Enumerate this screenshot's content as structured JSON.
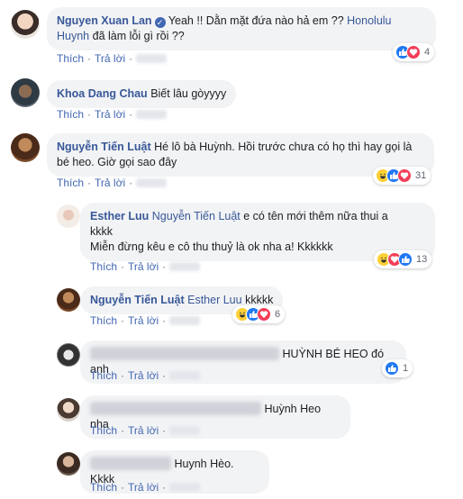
{
  "actions": {
    "like": "Thích",
    "reply": "Trả lời"
  },
  "comments": [
    {
      "author": "Nguyen Xuan Lan",
      "text_before": "Yeah !! Dằn mặt đứa nào hả em ?? ",
      "mention": "Honolulu Huynh",
      "text_after": " đã làm lỗi gì rồi ??",
      "reaction_count": "4"
    },
    {
      "author": "Khoa Dang Chau",
      "text": "Biết lâu gòyyyy"
    },
    {
      "author": "Nguyễn Tiến Luật",
      "text": "Hé lô bà Huỳnh. Hồi trước chưa có họ thì hay gọi là bé heo. Giờ gọi sao đây",
      "reaction_count": "31"
    },
    {
      "author": "Esther Luu",
      "mention": "Nguyễn Tiến Luật",
      "text_line1": " e có tên mới thêm nữa thui a",
      "text_line2": "kkkk",
      "text_line3": "Miễn đừng kêu e cô thu thuỷ là ok nha a! Kkkkkk",
      "reaction_count": "13"
    },
    {
      "author": "Nguyễn Tiến Luật",
      "mention": "Esther Luu",
      "text": " kkkkk",
      "reaction_count": "6"
    },
    {
      "text": "HUỲNH BÉ HEO đó anh",
      "reaction_count": "1"
    },
    {
      "text": "Huỳnh Heo nha"
    },
    {
      "text": "Huynh Hèo. Kkkk"
    }
  ],
  "colors": {
    "link": "#385898",
    "bubble": "#f2f3f5",
    "like": "#2078f4",
    "love": "#f33e58",
    "haha": "#fcd036"
  }
}
